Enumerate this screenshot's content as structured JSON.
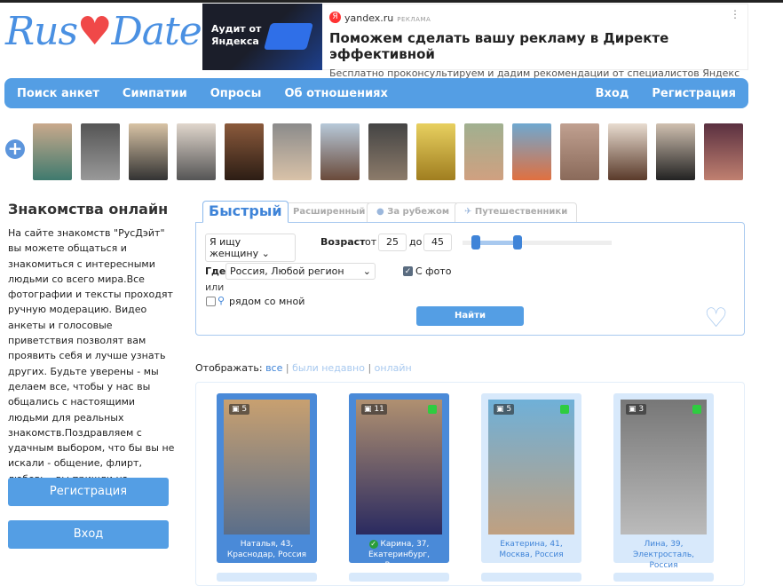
{
  "logo": {
    "left": "Rus",
    "right": "Date"
  },
  "ad": {
    "image_text": "Аудит от Яндекса",
    "domain": "yandex.ru",
    "label": "РЕКЛАМА",
    "title": "Поможем сделать вашу рекламу в Директе эффективной",
    "description": "Бесплатно проконсультируем и дадим рекомендации от специалистов Яндекс Директа"
  },
  "nav": {
    "items": [
      "Поиск анкет",
      "Симпатии",
      "Опросы",
      "Об отношениях"
    ],
    "login": "Вход",
    "register": "Регистрация"
  },
  "sidebar": {
    "title": "Знакомства онлайн",
    "text": "На сайте знакомств \"РусДэйт\" вы можете общаться и знакомиться с интересными людьми со всего мира.Все фотографии и тексты проходят ручную модерацию. Видео анкеты и голосовые приветствия позволят вам проявить себя и лучше узнать других. Будьте уверены - мы делаем все, чтобы у нас вы общались с настоящими людьми для реальных знакомств.Поздравляем с удачным выбором, что бы вы не искали - общение, флирт, любовь - вы пришли на правильный сайт!",
    "register": "Регистрация",
    "login": "Вход"
  },
  "search": {
    "tabs": [
      "Быстрый",
      "Расширенный",
      "За рубежом",
      "Путешественники"
    ],
    "looking_for": "Я ищу женщину",
    "age_label": "Возраст",
    "from_label": "от",
    "age_from": "25",
    "to_label": "до",
    "age_to": "45",
    "where_label": "Где",
    "region": "Россия, Любой регион",
    "with_photo": "С фото",
    "with_photo_checked": true,
    "or_label": "или",
    "nearby": "рядом со мной",
    "nearby_checked": false,
    "find": "Найти"
  },
  "display": {
    "label": "Отображать:",
    "all": "все",
    "recent": "были недавно",
    "online": "онлайн"
  },
  "profiles": [
    {
      "count": "5",
      "name": "Наталья, 43,",
      "city": "Краснодар, Россия",
      "online": false,
      "verified": false,
      "highlight": true
    },
    {
      "count": "11",
      "name": "Карина, 37,",
      "city": "Екатеринбург, Россия",
      "online": true,
      "verified": true,
      "highlight": true
    },
    {
      "count": "5",
      "name": "Екатерина, 41,",
      "city": "Москва, Россия",
      "online": true,
      "verified": false,
      "highlight": false
    },
    {
      "count": "3",
      "name": "Лина, 39,",
      "city": "Электросталь, Россия",
      "online": true,
      "verified": false,
      "highlight": false
    }
  ]
}
